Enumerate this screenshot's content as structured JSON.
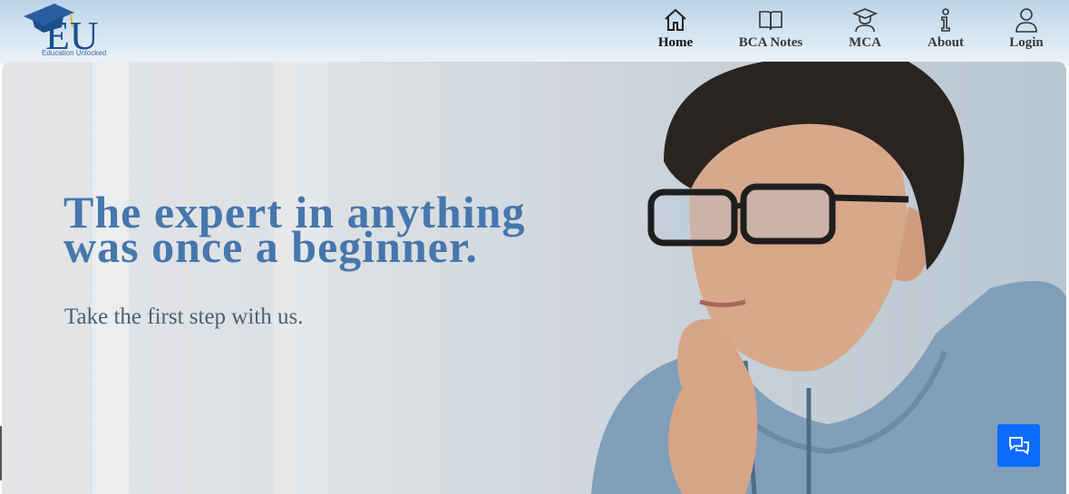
{
  "brand": {
    "logo_letters": "EU",
    "tagline": "Education Unlocked"
  },
  "nav": [
    {
      "label": "Home",
      "icon": "home-icon"
    },
    {
      "label": "BCA Notes",
      "icon": "book-icon"
    },
    {
      "label": "MCA",
      "icon": "graduate-icon"
    },
    {
      "label": "About",
      "icon": "info-icon"
    },
    {
      "label": "Login",
      "icon": "user-icon"
    }
  ],
  "hero": {
    "headline_line1": "The expert in anything",
    "headline_line2": "was once a beginner.",
    "subheadline": "Take the first step with us."
  },
  "colors": {
    "accent": "#4677ad",
    "chat_button": "#0a6cff",
    "header_top": "#b9d3e8"
  }
}
